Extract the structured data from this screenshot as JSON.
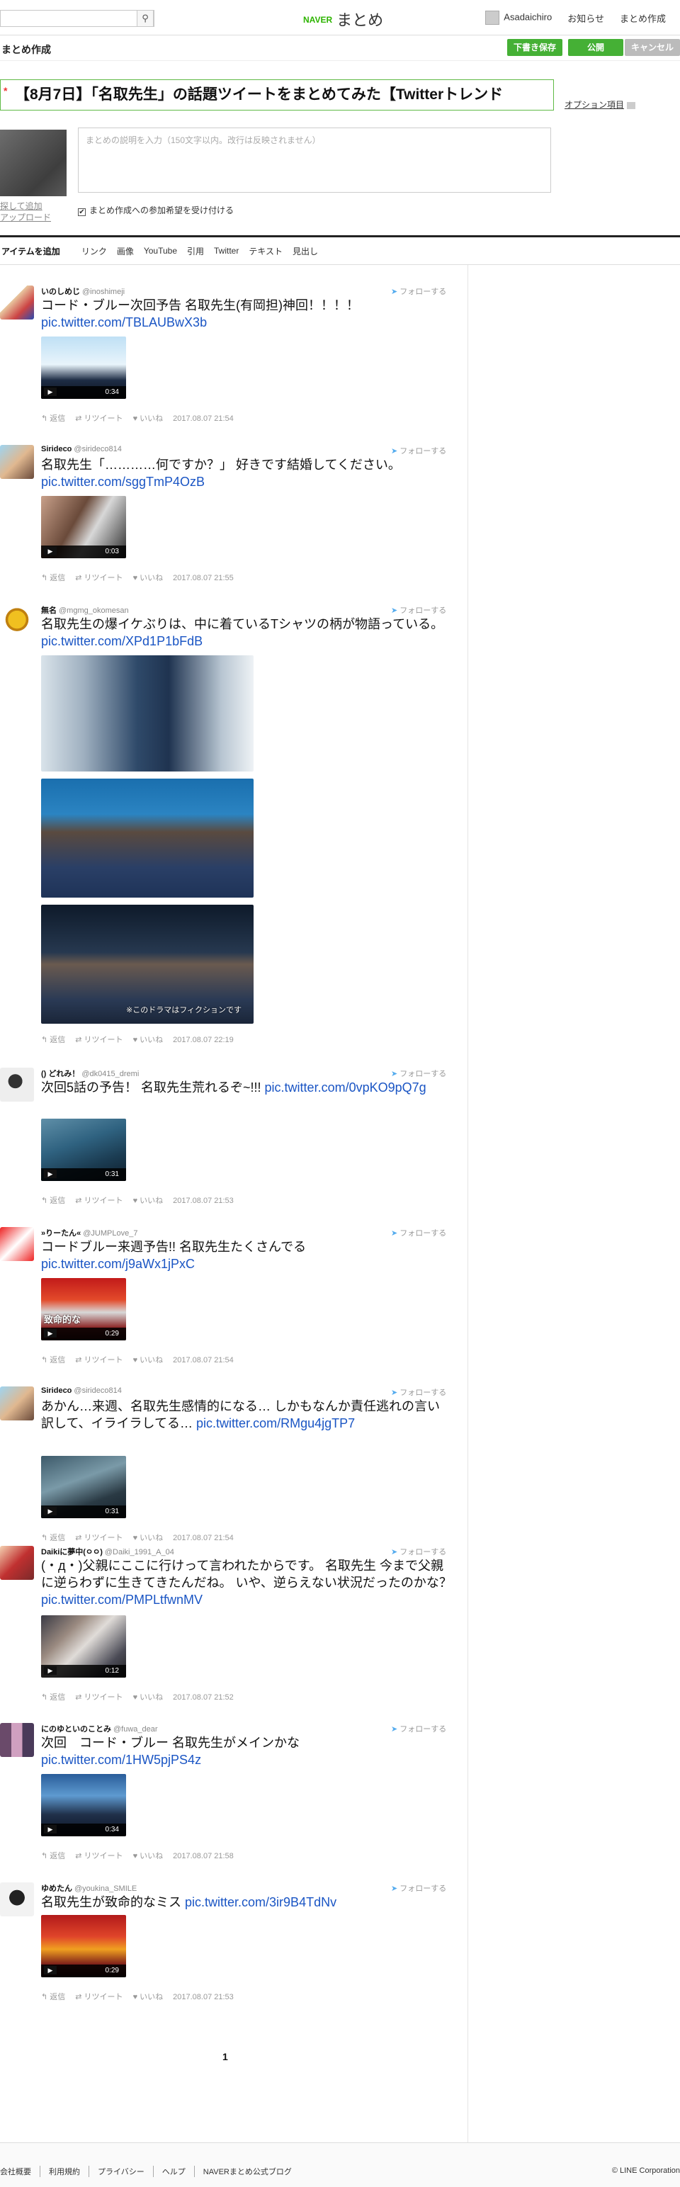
{
  "topbar": {
    "search_placeholder": "",
    "search_icon": "search-icon",
    "logo_brand": "NAVER",
    "logo_title": "まとめ",
    "username": "Asadaichiro",
    "notifications": "お知らせ",
    "create": "まとめ作成"
  },
  "editor": {
    "page_title": "まとめ作成",
    "save_draft": "下書き保存",
    "publish": "公開",
    "cancel": "キャンセル",
    "required_mark": "*",
    "title_value": "【8月7日】「名取先生」の話題ツイートをまとめてみた【Twitterトレンド",
    "option_link": "オプション項目",
    "thumb_link_1": "探して追加",
    "thumb_link_2": "アップロード",
    "description_placeholder": "まとめの説明を入力（150文字以内。改行は反映されません）",
    "participation_checkbox": "まとめ作成への参加希望を受け付ける",
    "participation_checked": "✔"
  },
  "item_bar": {
    "lead": "アイテムを追加",
    "items": [
      "リンク",
      "画像",
      "YouTube",
      "引用",
      "Twitter",
      "テキスト",
      "見出し"
    ]
  },
  "tweet_common": {
    "follow": "フォローする",
    "reply": "↰ 返信",
    "retweet": "⇄ リツイート",
    "like": "♥ いいね"
  },
  "tweets": [
    {
      "name": "いのしめじ",
      "handle": "@inoshimeji",
      "text": "コード・ブルー次回予告 名取先生(有岡担)神回！！！！",
      "link": "pic.twitter.com/TBLAUBwX3b",
      "duration": "0:34",
      "date": "2017.08.07 21:54"
    },
    {
      "name": "Sirideco",
      "handle": "@sirideco814",
      "text": "名取先生「…………何ですか？」 好きです結婚してください。",
      "link": "pic.twitter.com/sggTmP4OzB",
      "duration": "0:03",
      "date": "2017.08.07 21:55"
    },
    {
      "name": "無名",
      "handle": "@mgmg_okomesan",
      "text": "名取先生の爆イケぶりは、中に着ているTシャツの柄が物語っている。",
      "link": "pic.twitter.com/XPd1P1bFdB",
      "duration": "",
      "date": "2017.08.07 22:19",
      "caption": "※このドラマはフィクションです"
    },
    {
      "name": "() どれみ！",
      "handle": "@dk0415_dremi",
      "text": "次回5話の予告！ 名取先生荒れるぞ~!!!",
      "link": "pic.twitter.com/0vpKO9pQ7g",
      "duration": "0:31",
      "date": "2017.08.07 21:53"
    },
    {
      "name": "»りーたん«",
      "handle": "@JUMPLove_7",
      "text": "コードブルー来週予告!! 名取先生たくさんでる",
      "link": "pic.twitter.com/j9aWx1jPxC",
      "duration": "0:29",
      "date": "2017.08.07 21:54",
      "caption": "致命的な"
    },
    {
      "name": "Sirideco",
      "handle": "@sirideco814",
      "text": "あかん…来週、名取先生感情的になる… しかもなんか責任逃れの言い訳して、イライラしてる…",
      "link": "pic.twitter.com/RMgu4jgTP7",
      "duration": "0:31",
      "date": "2017.08.07 21:54"
    },
    {
      "name": "Daikiに夢中(ㅇㅇ)",
      "handle": "@Daiki_1991_A_04",
      "text": "(・д・)父親にここに行けって言われたからです。 名取先生 今まで父親に逆らわずに生きてきたんだね。 いや、逆らえない状況だったのかな？",
      "link": "pic.twitter.com/PMPLtfwnMV",
      "duration": "0:12",
      "date": "2017.08.07 21:52"
    },
    {
      "name": "にのゆといのことみ",
      "handle": "@fuwa_dear",
      "text": "次回　コード・ブルー 名取先生がメインかな",
      "link": "pic.twitter.com/1HW5pjPS4z",
      "duration": "0:34",
      "date": "2017.08.07 21:58"
    },
    {
      "name": "ゆめたん",
      "handle": "@youkina_SMILE",
      "text": "名取先生が致命的なミス",
      "link": "pic.twitter.com/3ir9B4TdNv",
      "duration": "0:29",
      "date": "2017.08.07 21:53"
    }
  ],
  "pager": {
    "current": "1"
  },
  "footer": {
    "links": [
      "会社概要",
      "利用規約",
      "プライバシー",
      "ヘルプ",
      "NAVERまとめ公式ブログ"
    ],
    "copyright": "© LINE Corporation"
  }
}
